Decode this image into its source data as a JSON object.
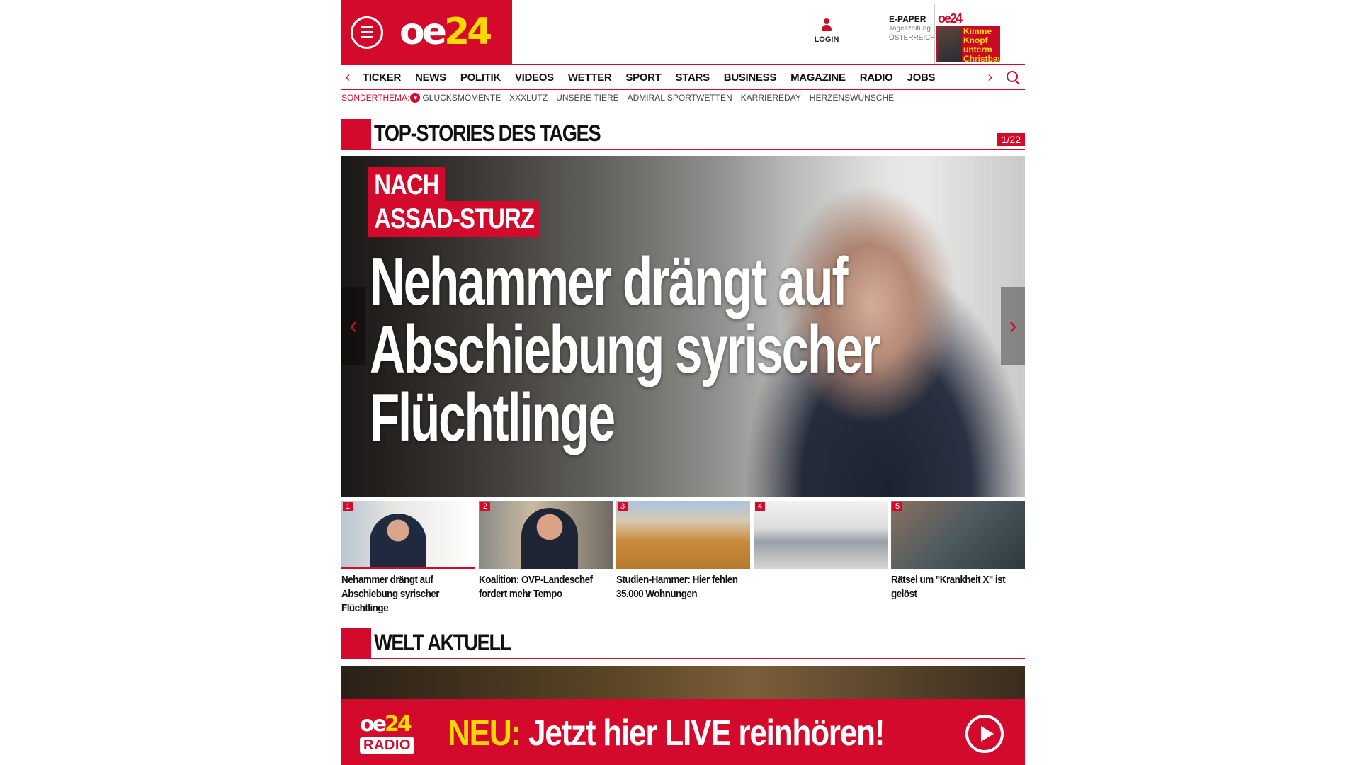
{
  "header": {
    "logo_main": "oe",
    "logo_num": "24",
    "login_label": "LOGIN",
    "epaper_title": "E-PAPER",
    "epaper_sub1": "Tageszeitung",
    "epaper_sub2": "ÖSTERREICH",
    "epaper_cover_logo": "oe24",
    "epaper_cover_headline": "Kimme Knopf unterm Christbaum"
  },
  "nav": {
    "items": [
      "TICKER",
      "NEWS",
      "POLITIK",
      "VIDEOS",
      "WETTER",
      "SPORT",
      "STARS",
      "BUSINESS",
      "MAGAZINE",
      "RADIO",
      "JOBS"
    ],
    "prev_arrow": "‹",
    "next_arrow": "›"
  },
  "subnav": {
    "label": "SONDERTHEMA:",
    "items": [
      "GLÜCKSMOMENTE",
      "XXXLUTZ",
      "UNSERE TIERE",
      "ADMIRAL SPORTWETTEN",
      "KARRIEREDAY",
      "HERZENSWÜNSCHE"
    ]
  },
  "top_stories": {
    "title": "TOP-STORIES DES TAGES",
    "counter": "1/22",
    "hero": {
      "tag_line1": "NACH",
      "tag_line2": "ASSAD-STURZ",
      "headline": "Nehammer drängt auf Abschiebung syrischer Flüchtlinge",
      "prev_arrow": "‹",
      "next_arrow": "›"
    },
    "thumbs": [
      {
        "num": "1",
        "caption": "Nehammer drängt auf Abschiebung syrischer Flüchtlinge"
      },
      {
        "num": "2",
        "caption": "Koalition: OVP-Landeschef fordert mehr Tempo"
      },
      {
        "num": "3",
        "caption": "Studien-Hammer: Hier fehlen 35.000 Wohnungen"
      },
      {
        "num": "4",
        "caption": ""
      },
      {
        "num": "5",
        "caption": "Rätsel um \"Krankheit X\" ist gelöst"
      }
    ]
  },
  "welt": {
    "title": "WELT AKTUELL"
  },
  "radio_banner": {
    "logo_main": "oe",
    "logo_num": "24",
    "logo_word": "RADIO",
    "neu": "NEU:",
    "text": "Jetzt hier LIVE reinhören!"
  },
  "colors": {
    "brand_red": "#d30a2c",
    "brand_yellow": "#ffd800"
  }
}
